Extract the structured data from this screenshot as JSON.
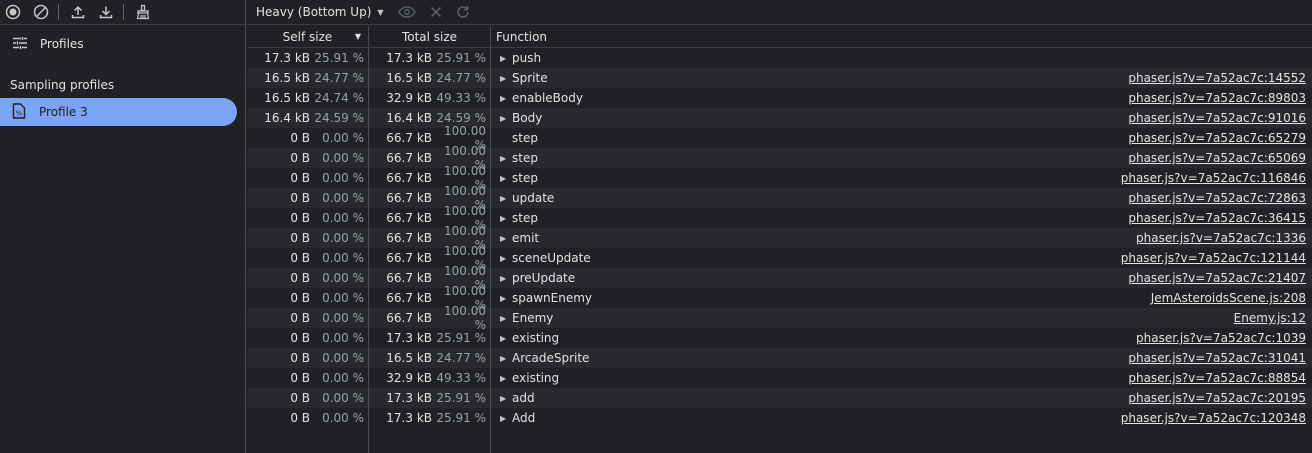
{
  "sidebar": {
    "profiles_label": "Profiles",
    "section_heading": "Sampling profiles",
    "profile_item": "Profile 3"
  },
  "toolbar": {
    "view_mode": "Heavy (Bottom Up)"
  },
  "table": {
    "headers": {
      "self": "Self size",
      "total": "Total size",
      "function": "Function"
    },
    "rows": [
      {
        "self": "17.3 kB",
        "self_pct": "25.91 %",
        "total": "17.3 kB",
        "total_pct": "25.91 %",
        "expand": true,
        "fn": "push",
        "src": ""
      },
      {
        "self": "16.5 kB",
        "self_pct": "24.77 %",
        "total": "16.5 kB",
        "total_pct": "24.77 %",
        "expand": true,
        "fn": "Sprite",
        "src": "phaser.js?v=7a52ac7c:14552"
      },
      {
        "self": "16.5 kB",
        "self_pct": "24.74 %",
        "total": "32.9 kB",
        "total_pct": "49.33 %",
        "expand": true,
        "fn": "enableBody",
        "src": "phaser.js?v=7a52ac7c:89803"
      },
      {
        "self": "16.4 kB",
        "self_pct": "24.59 %",
        "total": "16.4 kB",
        "total_pct": "24.59 %",
        "expand": true,
        "fn": "Body",
        "src": "phaser.js?v=7a52ac7c:91016"
      },
      {
        "self": "0 B",
        "self_pct": "0.00 %",
        "total": "66.7 kB",
        "total_pct": "100.00 %",
        "expand": false,
        "fn": "step",
        "src": "phaser.js?v=7a52ac7c:65279"
      },
      {
        "self": "0 B",
        "self_pct": "0.00 %",
        "total": "66.7 kB",
        "total_pct": "100.00 %",
        "expand": true,
        "fn": "step",
        "src": "phaser.js?v=7a52ac7c:65069"
      },
      {
        "self": "0 B",
        "self_pct": "0.00 %",
        "total": "66.7 kB",
        "total_pct": "100.00 %",
        "expand": true,
        "fn": "step",
        "src": "phaser.js?v=7a52ac7c:116846"
      },
      {
        "self": "0 B",
        "self_pct": "0.00 %",
        "total": "66.7 kB",
        "total_pct": "100.00 %",
        "expand": true,
        "fn": "update",
        "src": "phaser.js?v=7a52ac7c:72863"
      },
      {
        "self": "0 B",
        "self_pct": "0.00 %",
        "total": "66.7 kB",
        "total_pct": "100.00 %",
        "expand": true,
        "fn": "step",
        "src": "phaser.js?v=7a52ac7c:36415"
      },
      {
        "self": "0 B",
        "self_pct": "0.00 %",
        "total": "66.7 kB",
        "total_pct": "100.00 %",
        "expand": true,
        "fn": "emit",
        "src": "phaser.js?v=7a52ac7c:1336"
      },
      {
        "self": "0 B",
        "self_pct": "0.00 %",
        "total": "66.7 kB",
        "total_pct": "100.00 %",
        "expand": true,
        "fn": "sceneUpdate",
        "src": "phaser.js?v=7a52ac7c:121144"
      },
      {
        "self": "0 B",
        "self_pct": "0.00 %",
        "total": "66.7 kB",
        "total_pct": "100.00 %",
        "expand": true,
        "fn": "preUpdate",
        "src": "phaser.js?v=7a52ac7c:21407"
      },
      {
        "self": "0 B",
        "self_pct": "0.00 %",
        "total": "66.7 kB",
        "total_pct": "100.00 %",
        "expand": true,
        "fn": "spawnEnemy",
        "src": "JemAsteroidsScene.js:208"
      },
      {
        "self": "0 B",
        "self_pct": "0.00 %",
        "total": "66.7 kB",
        "total_pct": "100.00 %",
        "expand": true,
        "fn": "Enemy",
        "src": "Enemy.js:12"
      },
      {
        "self": "0 B",
        "self_pct": "0.00 %",
        "total": "17.3 kB",
        "total_pct": "25.91 %",
        "expand": true,
        "fn": "existing",
        "src": "phaser.js?v=7a52ac7c:1039"
      },
      {
        "self": "0 B",
        "self_pct": "0.00 %",
        "total": "16.5 kB",
        "total_pct": "24.77 %",
        "expand": true,
        "fn": "ArcadeSprite",
        "src": "phaser.js?v=7a52ac7c:31041"
      },
      {
        "self": "0 B",
        "self_pct": "0.00 %",
        "total": "32.9 kB",
        "total_pct": "49.33 %",
        "expand": true,
        "fn": "existing",
        "src": "phaser.js?v=7a52ac7c:88854"
      },
      {
        "self": "0 B",
        "self_pct": "0.00 %",
        "total": "17.3 kB",
        "total_pct": "25.91 %",
        "expand": true,
        "fn": "add",
        "src": "phaser.js?v=7a52ac7c:20195"
      },
      {
        "self": "0 B",
        "self_pct": "0.00 %",
        "total": "17.3 kB",
        "total_pct": "25.91 %",
        "expand": true,
        "fn": "Add",
        "src": "phaser.js?v=7a52ac7c:120348"
      }
    ]
  },
  "colors": {
    "background": "#202124",
    "selected": "#7ba4f4",
    "stripe": "#28292c"
  }
}
